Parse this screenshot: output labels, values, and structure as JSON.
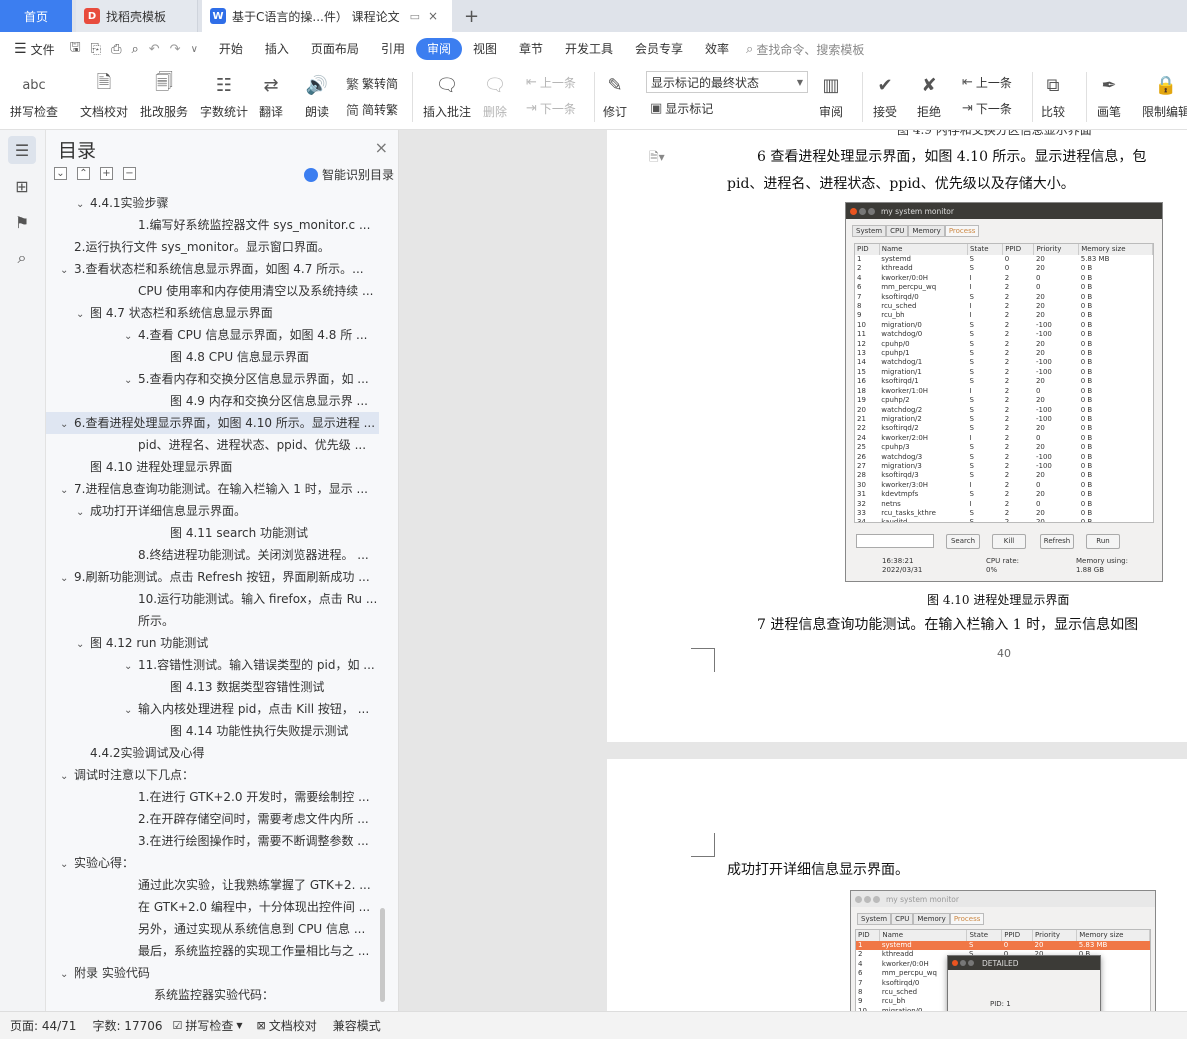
{
  "tabs": [
    {
      "label": "首页"
    },
    {
      "label": "找稻壳模板"
    },
    {
      "label": "基于C语言的操...件） 课程论文"
    }
  ],
  "menu": {
    "file": "文件",
    "items": [
      "开始",
      "插入",
      "页面布局",
      "引用",
      "审阅",
      "视图",
      "章节",
      "开发工具",
      "会员专享",
      "效率"
    ],
    "search_placeholder": "查找命令、搜索模板"
  },
  "toolbar": {
    "spell": "拼写检查",
    "proof": "文档校对",
    "revise_service": "批改服务",
    "word_count": "字数统计",
    "translate": "翻译",
    "read": "朗读",
    "to_trad": "繁转简",
    "to_simp": "简转繁",
    "insert_comment": "插入批注",
    "delete": "删除",
    "prev_comment": "上一条",
    "next_comment": "下一条",
    "track": "修订",
    "markup_select": "显示标记的最终状态",
    "show_markup": "显示标记",
    "review": "审阅",
    "accept": "接受",
    "reject": "拒绝",
    "prev_change": "上一条",
    "next_change": "下一条",
    "compare": "比较",
    "ink": "画笔",
    "restrict": "限制编辑"
  },
  "toc": {
    "title": "目录",
    "smart_label": "智能识别目录",
    "items": [
      {
        "text": "4.4.1实验步骤",
        "level": 2,
        "caret": "v"
      },
      {
        "text": "1.编写好系统监控器文件 sys_monitor.c ...",
        "level": 4,
        "caret": ""
      },
      {
        "text": "2.运行执行文件 sys_monitor。显示窗口界面。",
        "level": 1,
        "caret": ""
      },
      {
        "text": "3.查看状态栏和系统信息显示界面，如图 4.7 所示。...",
        "level": 1,
        "caret": "v"
      },
      {
        "text": "CPU 使用率和内存使用清空以及系统持续 ...",
        "level": 4,
        "caret": ""
      },
      {
        "text": "图 4.7 状态栏和系统信息显示界面",
        "level": 2,
        "caret": "v"
      },
      {
        "text": "4.查看 CPU 信息显示界面，如图 4.8 所 ...",
        "level": 4,
        "caret": "v"
      },
      {
        "text": "图 4.8 CPU 信息显示界面",
        "level": 5,
        "caret": ""
      },
      {
        "text": "5.查看内存和交换分区信息显示界面，如 ...",
        "level": 4,
        "caret": "v"
      },
      {
        "text": "图 4.9 内存和交换分区信息显示界 ...",
        "level": 5,
        "caret": ""
      },
      {
        "text": "6.查看进程处理显示界面，如图 4.10 所示。显示进程 ...",
        "level": 1,
        "caret": "v",
        "selected": true
      },
      {
        "text": "pid、进程名、进程状态、ppid、优先级 ...",
        "level": 4,
        "caret": ""
      },
      {
        "text": "图 4.10 进程处理显示界面",
        "level": 2,
        "caret": ""
      },
      {
        "text": "7.进程信息查询功能测试。在输入栏输入 1 时，显示 ...",
        "level": 1,
        "caret": "v"
      },
      {
        "text": "成功打开详细信息显示界面。",
        "level": 2,
        "caret": "v"
      },
      {
        "text": "图 4.11 search 功能测试",
        "level": 5,
        "caret": ""
      },
      {
        "text": "8.终结进程功能测试。关闭浏览器进程。 ...",
        "level": 4,
        "caret": ""
      },
      {
        "text": "9.刷新功能测试。点击 Refresh 按钮，界面刷新成功 ...",
        "level": 1,
        "caret": "v"
      },
      {
        "text": "10.运行功能测试。输入 firefox，点击 Ru ...",
        "level": 4,
        "caret": ""
      },
      {
        "text": "所示。",
        "level": 4,
        "caret": ""
      },
      {
        "text": "图 4.12 run 功能测试",
        "level": 2,
        "caret": "v"
      },
      {
        "text": "11.容错性测试。输入错误类型的 pid，如 ...",
        "level": 4,
        "caret": "v"
      },
      {
        "text": "图 4.13 数据类型容错性测试",
        "level": 5,
        "caret": ""
      },
      {
        "text": "输入内核处理进程 pid，点击 Kill 按钮， ...",
        "level": 4,
        "caret": "v"
      },
      {
        "text": "图 4.14 功能性执行失败提示测试",
        "level": 5,
        "caret": ""
      },
      {
        "text": "4.4.2实验调试及心得",
        "level": 2,
        "caret": ""
      },
      {
        "text": "调试时注意以下几点：",
        "level": 1,
        "caret": "v"
      },
      {
        "text": "1.在进行 GTK+2.0 开发时，需要绘制控 ...",
        "level": 4,
        "caret": ""
      },
      {
        "text": "2.在开辟存储空间时，需要考虑文件内所 ...",
        "level": 4,
        "caret": ""
      },
      {
        "text": "3.在进行绘图操作时，需要不断调整参数 ...",
        "level": 4,
        "caret": ""
      },
      {
        "text": "实验心得：",
        "level": 1,
        "caret": "v"
      },
      {
        "text": "通过此次实验，让我熟练掌握了 GTK+2. ...",
        "level": 4,
        "caret": ""
      },
      {
        "text": "在 GTK+2.0 编程中，十分体现出控件间 ...",
        "level": 4,
        "caret": ""
      },
      {
        "text": "另外，通过实现从系统信息到 CPU 信息 ...",
        "level": 4,
        "caret": ""
      },
      {
        "text": "最后，系统监控器的实现工作量相比与之 ...",
        "level": 4,
        "caret": ""
      },
      {
        "text": "附录 实验代码",
        "level": 1,
        "caret": "v"
      },
      {
        "text": "系统监控器实验代码：",
        "level": 6,
        "caret": ""
      }
    ]
  },
  "doc": {
    "top_caption": "图 4.9 内存和交换分区信息显示界面",
    "para6_line1": "6 查看进程处理显示界面，如图 4.10 所示。显示进程信息，包",
    "para6_line2": "pid、进程名、进程状态、ppid、优先级以及存储大小。",
    "fig_caption": "图 4.10 进程处理显示界面",
    "para7": "7 进程信息查询功能测试。在输入栏输入 1 时，显示信息如图",
    "page_number": "40",
    "page2_line": "成功打开详细信息显示界面。"
  },
  "monitor": {
    "title": "my system monitor",
    "tabs": [
      "System",
      "CPU",
      "Memory",
      "Process"
    ],
    "columns": [
      "PID",
      "Name",
      "State",
      "PPID",
      "Priority",
      "Memory size"
    ],
    "rows": [
      [
        "1",
        "systemd",
        "S",
        "0",
        "20",
        "5.83 MB"
      ],
      [
        "2",
        "kthreadd",
        "S",
        "0",
        "20",
        "0 B"
      ],
      [
        "4",
        "kworker/0:0H",
        "I",
        "2",
        "0",
        "0 B"
      ],
      [
        "6",
        "mm_percpu_wq",
        "I",
        "2",
        "0",
        "0 B"
      ],
      [
        "7",
        "ksoftirqd/0",
        "S",
        "2",
        "20",
        "0 B"
      ],
      [
        "8",
        "rcu_sched",
        "I",
        "2",
        "20",
        "0 B"
      ],
      [
        "9",
        "rcu_bh",
        "I",
        "2",
        "20",
        "0 B"
      ],
      [
        "10",
        "migration/0",
        "S",
        "2",
        "-100",
        "0 B"
      ],
      [
        "11",
        "watchdog/0",
        "S",
        "2",
        "-100",
        "0 B"
      ],
      [
        "12",
        "cpuhp/0",
        "S",
        "2",
        "20",
        "0 B"
      ],
      [
        "13",
        "cpuhp/1",
        "S",
        "2",
        "20",
        "0 B"
      ],
      [
        "14",
        "watchdog/1",
        "S",
        "2",
        "-100",
        "0 B"
      ],
      [
        "15",
        "migration/1",
        "S",
        "2",
        "-100",
        "0 B"
      ],
      [
        "16",
        "ksoftirqd/1",
        "S",
        "2",
        "20",
        "0 B"
      ],
      [
        "18",
        "kworker/1:0H",
        "I",
        "2",
        "0",
        "0 B"
      ],
      [
        "19",
        "cpuhp/2",
        "S",
        "2",
        "20",
        "0 B"
      ],
      [
        "20",
        "watchdog/2",
        "S",
        "2",
        "-100",
        "0 B"
      ],
      [
        "21",
        "migration/2",
        "S",
        "2",
        "-100",
        "0 B"
      ],
      [
        "22",
        "ksoftirqd/2",
        "S",
        "2",
        "20",
        "0 B"
      ],
      [
        "24",
        "kworker/2:0H",
        "I",
        "2",
        "0",
        "0 B"
      ],
      [
        "25",
        "cpuhp/3",
        "S",
        "2",
        "20",
        "0 B"
      ],
      [
        "26",
        "watchdog/3",
        "S",
        "2",
        "-100",
        "0 B"
      ],
      [
        "27",
        "migration/3",
        "S",
        "2",
        "-100",
        "0 B"
      ],
      [
        "28",
        "ksoftirqd/3",
        "S",
        "2",
        "20",
        "0 B"
      ],
      [
        "30",
        "kworker/3:0H",
        "I",
        "2",
        "0",
        "0 B"
      ],
      [
        "31",
        "kdevtmpfs",
        "S",
        "2",
        "20",
        "0 B"
      ],
      [
        "32",
        "netns",
        "I",
        "2",
        "0",
        "0 B"
      ],
      [
        "33",
        "rcu_tasks_kthre",
        "S",
        "2",
        "20",
        "0 B"
      ],
      [
        "34",
        "kauditd",
        "S",
        "2",
        "20",
        "0 B"
      ]
    ],
    "buttons": [
      "Search",
      "Kill",
      "Refresh",
      "Run"
    ],
    "time": "16:38:21",
    "date": "2022/03/31",
    "cpu_label": "CPU rate:",
    "cpu_value": "0%",
    "mem_label": "Memory using:",
    "mem_value": "1.88 GB"
  },
  "monitor2": {
    "title": "my system monitor",
    "tabs": [
      "System",
      "CPU",
      "Memory",
      "Process"
    ],
    "columns": [
      "PID",
      "Name",
      "State",
      "PPID",
      "Priority",
      "Memory size"
    ],
    "rows": [
      [
        "1",
        "systemd",
        "S",
        "0",
        "20",
        "5.83 MB"
      ],
      [
        "2",
        "kthreadd",
        "S",
        "0",
        "20",
        "0 B"
      ],
      [
        "4",
        "kworker/0:0H",
        "I",
        "2",
        "0",
        "0 B"
      ],
      [
        "6",
        "mm_percpu_wq",
        "I",
        "2",
        "0",
        "0 B"
      ],
      [
        "7",
        "ksoftirqd/0",
        "S",
        "2",
        "20",
        "0 B"
      ],
      [
        "8",
        "rcu_sched",
        "I",
        "2",
        "20",
        "0 B"
      ],
      [
        "9",
        "rcu_bh",
        "I",
        "2",
        "20",
        "0 B"
      ],
      [
        "10",
        "migration/0",
        "S",
        "2",
        "-100",
        "0 B"
      ]
    ],
    "dialog_title": "DETAILED",
    "dialog_pid": "PID: 1"
  },
  "status": {
    "page": "页面: 44/71",
    "words": "字数: 17706",
    "spell": "拼写检查",
    "proof": "文档校对",
    "compat": "兼容模式"
  },
  "colors": {
    "accent": "#3c7ef0",
    "highlight_row": "#f07746"
  }
}
